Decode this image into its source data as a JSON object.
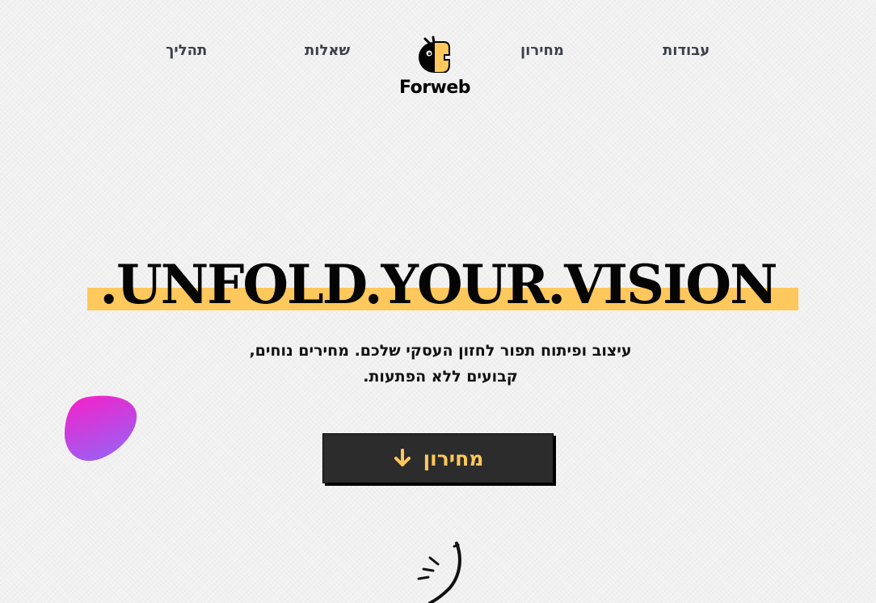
{
  "nav": {
    "items": [
      {
        "id": "works",
        "label": "עבודות"
      },
      {
        "id": "pricing",
        "label": "מחירון"
      },
      {
        "id": "questions",
        "label": "שאלות"
      },
      {
        "id": "process",
        "label": "תהליך"
      }
    ],
    "logo_text": "Forweb"
  },
  "hero": {
    "title": ".UNFOLD.YOUR.VISION",
    "subtitle_line1": "עיצוב ופיתוח תפור לחזון העסקי שלכם. מחירים נוחים,",
    "subtitle_line2": "קבועים ללא הפתעות.",
    "cta_label": "מחירון",
    "cta_icon": "arrow-down-icon"
  },
  "colors": {
    "accent": "#ffc85c",
    "button_bg": "#2c2c2c",
    "blob_start": "#f81fc9",
    "blob_end": "#a05cf0"
  }
}
